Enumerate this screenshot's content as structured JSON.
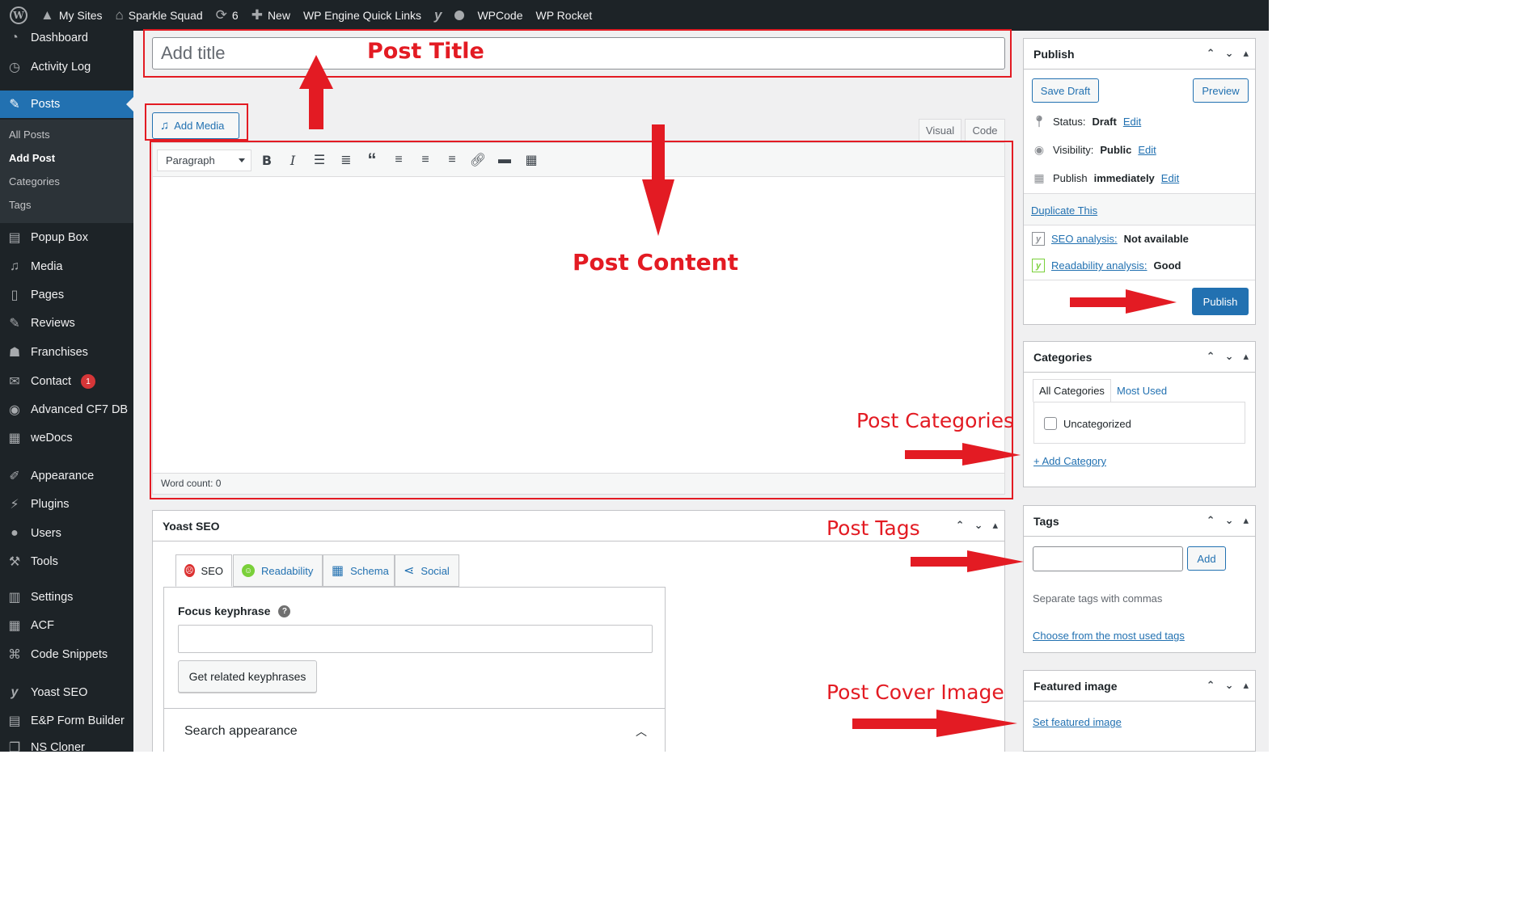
{
  "adminbar": {
    "items": [
      {
        "label": "My Sites",
        "icon": "my-sites-icon"
      },
      {
        "label": "Sparkle Squad",
        "icon": "home-icon"
      },
      {
        "label": "6",
        "icon": "updates-icon"
      },
      {
        "label": "New",
        "icon": "plus-icon"
      },
      {
        "label": "WP Engine Quick Links"
      },
      {
        "label": "",
        "icon": "yoast-icon"
      },
      {
        "label": "",
        "icon": "status-dot-icon"
      },
      {
        "label": "WPCode"
      },
      {
        "label": "WP Rocket"
      }
    ]
  },
  "sidebar": {
    "items": [
      {
        "label": "Dashboard",
        "icon": "dashboard-icon"
      },
      {
        "label": "Activity Log",
        "icon": "clock-icon"
      },
      {
        "label": "Posts",
        "icon": "pin-icon",
        "active": true
      },
      {
        "label": "Popup Box",
        "icon": "popup-icon"
      },
      {
        "label": "Media",
        "icon": "media-icon"
      },
      {
        "label": "Pages",
        "icon": "pages-icon"
      },
      {
        "label": "Reviews",
        "icon": "pin-icon"
      },
      {
        "label": "Franchises",
        "icon": "franchise-icon"
      },
      {
        "label": "Contact",
        "icon": "mail-icon",
        "badge": "1"
      },
      {
        "label": "Advanced CF7 DB",
        "icon": "eye-icon"
      },
      {
        "label": "weDocs",
        "icon": "docs-icon"
      },
      {
        "label": "Appearance",
        "icon": "brush-icon"
      },
      {
        "label": "Plugins",
        "icon": "plugin-icon"
      },
      {
        "label": "Users",
        "icon": "user-icon"
      },
      {
        "label": "Tools",
        "icon": "wrench-icon"
      },
      {
        "label": "Settings",
        "icon": "settings-icon"
      },
      {
        "label": "ACF",
        "icon": "acf-icon"
      },
      {
        "label": "Code Snippets",
        "icon": "code-icon"
      },
      {
        "label": "Yoast SEO",
        "icon": "yoast-icon"
      },
      {
        "label": "E&P Form Builder",
        "icon": "form-icon"
      },
      {
        "label": "NS Cloner",
        "icon": "cloner-icon"
      }
    ],
    "submenu": [
      "All Posts",
      "Add Post",
      "Categories",
      "Tags"
    ]
  },
  "editor": {
    "title_placeholder": "Add title",
    "add_media": "Add Media",
    "tab_visual": "Visual",
    "tab_code": "Code",
    "format_select": "Paragraph",
    "word_count": "Word count: 0"
  },
  "yoast": {
    "title": "Yoast SEO",
    "tabs": [
      "SEO",
      "Readability",
      "Schema",
      "Social"
    ],
    "focus_label": "Focus keyphrase",
    "related_button": "Get related keyphrases",
    "search_appearance": "Search appearance"
  },
  "publish": {
    "title": "Publish",
    "save_draft": "Save Draft",
    "preview": "Preview",
    "status_label": "Status:",
    "status_value": "Draft",
    "visibility_label": "Visibility:",
    "visibility_value": "Public",
    "publish_label": "Publish",
    "publish_value": "immediately",
    "edit": "Edit",
    "duplicate": "Duplicate This",
    "seo_link": "SEO analysis:",
    "seo_value": "Not available",
    "readability_link": "Readability analysis:",
    "readability_value": "Good",
    "publish_button": "Publish"
  },
  "categories": {
    "title": "Categories",
    "tab_all": "All Categories",
    "tab_most": "Most Used",
    "item": "Uncategorized",
    "add": "+ Add Category"
  },
  "tags": {
    "title": "Tags",
    "add": "Add",
    "hint": "Separate tags with commas",
    "choose": "Choose from the most used tags"
  },
  "featured": {
    "title": "Featured image",
    "set": "Set featured image"
  },
  "annotations": {
    "post_title": "Post Title",
    "post_content": "Post Content",
    "post_categories": "Post Categories",
    "post_tags": "Post Tags",
    "post_cover": "Post Cover Image"
  },
  "colors": {
    "accent": "#2271b1",
    "annotation": "#e31b23",
    "admin_dark": "#1d2327"
  }
}
